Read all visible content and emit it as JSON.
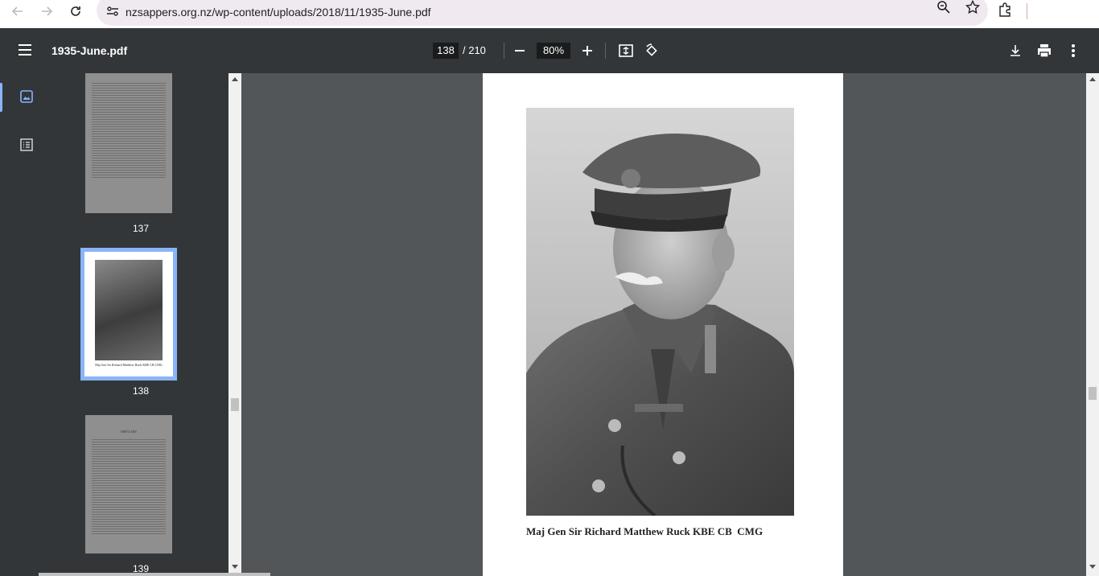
{
  "browser": {
    "url": "nzsappers.org.nz/wp-content/uploads/2018/11/1935-June.pdf"
  },
  "toolbar": {
    "title": "1935-June.pdf",
    "current_page": "138",
    "total_pages": "/ 210",
    "zoom": "80%"
  },
  "thumbnails": [
    {
      "page": "137"
    },
    {
      "page": "138",
      "caption": "Maj Gen Sir Richard Matthew Ruck KBE CB  CMG"
    },
    {
      "page": "139",
      "heading": "OBITUARY"
    }
  ],
  "page": {
    "caption": "Maj Gen Sir Richard Matthew Ruck KBE CB  CMG"
  },
  "colors": {
    "accent": "#8ab4f8",
    "toolbar_bg": "#323639",
    "viewer_bg": "#525659"
  }
}
